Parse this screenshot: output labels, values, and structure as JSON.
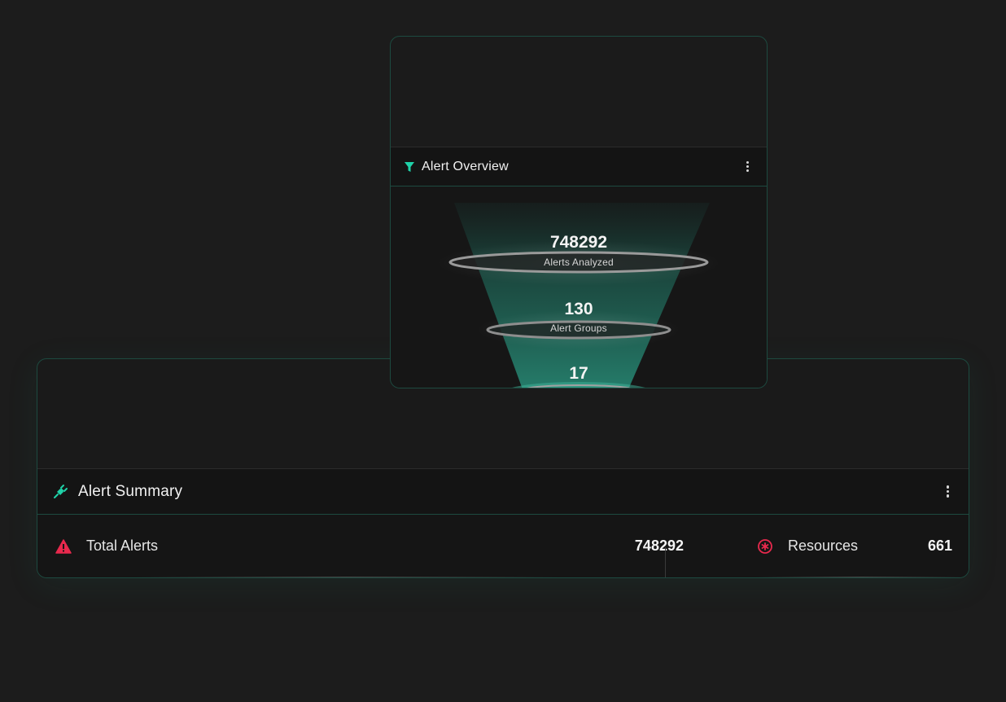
{
  "colors": {
    "accent": "#1fd1a8",
    "danger": "#e8294d",
    "border": "#1d4a40"
  },
  "overview": {
    "title": "Alert Overview",
    "icon": "filter-icon",
    "stages": [
      {
        "value": "748292",
        "label": "Alerts Analyzed"
      },
      {
        "value": "130",
        "label": "Alert Groups"
      },
      {
        "value": "17"
      }
    ]
  },
  "summary": {
    "title": "Alert Summary",
    "icon": "plug-icon",
    "metrics": [
      {
        "icon": "warning-triangle-icon",
        "label": "Total Alerts",
        "value": "748292"
      },
      {
        "icon": "asterisk-circle-icon",
        "label": "Resources",
        "value": "661"
      }
    ]
  }
}
